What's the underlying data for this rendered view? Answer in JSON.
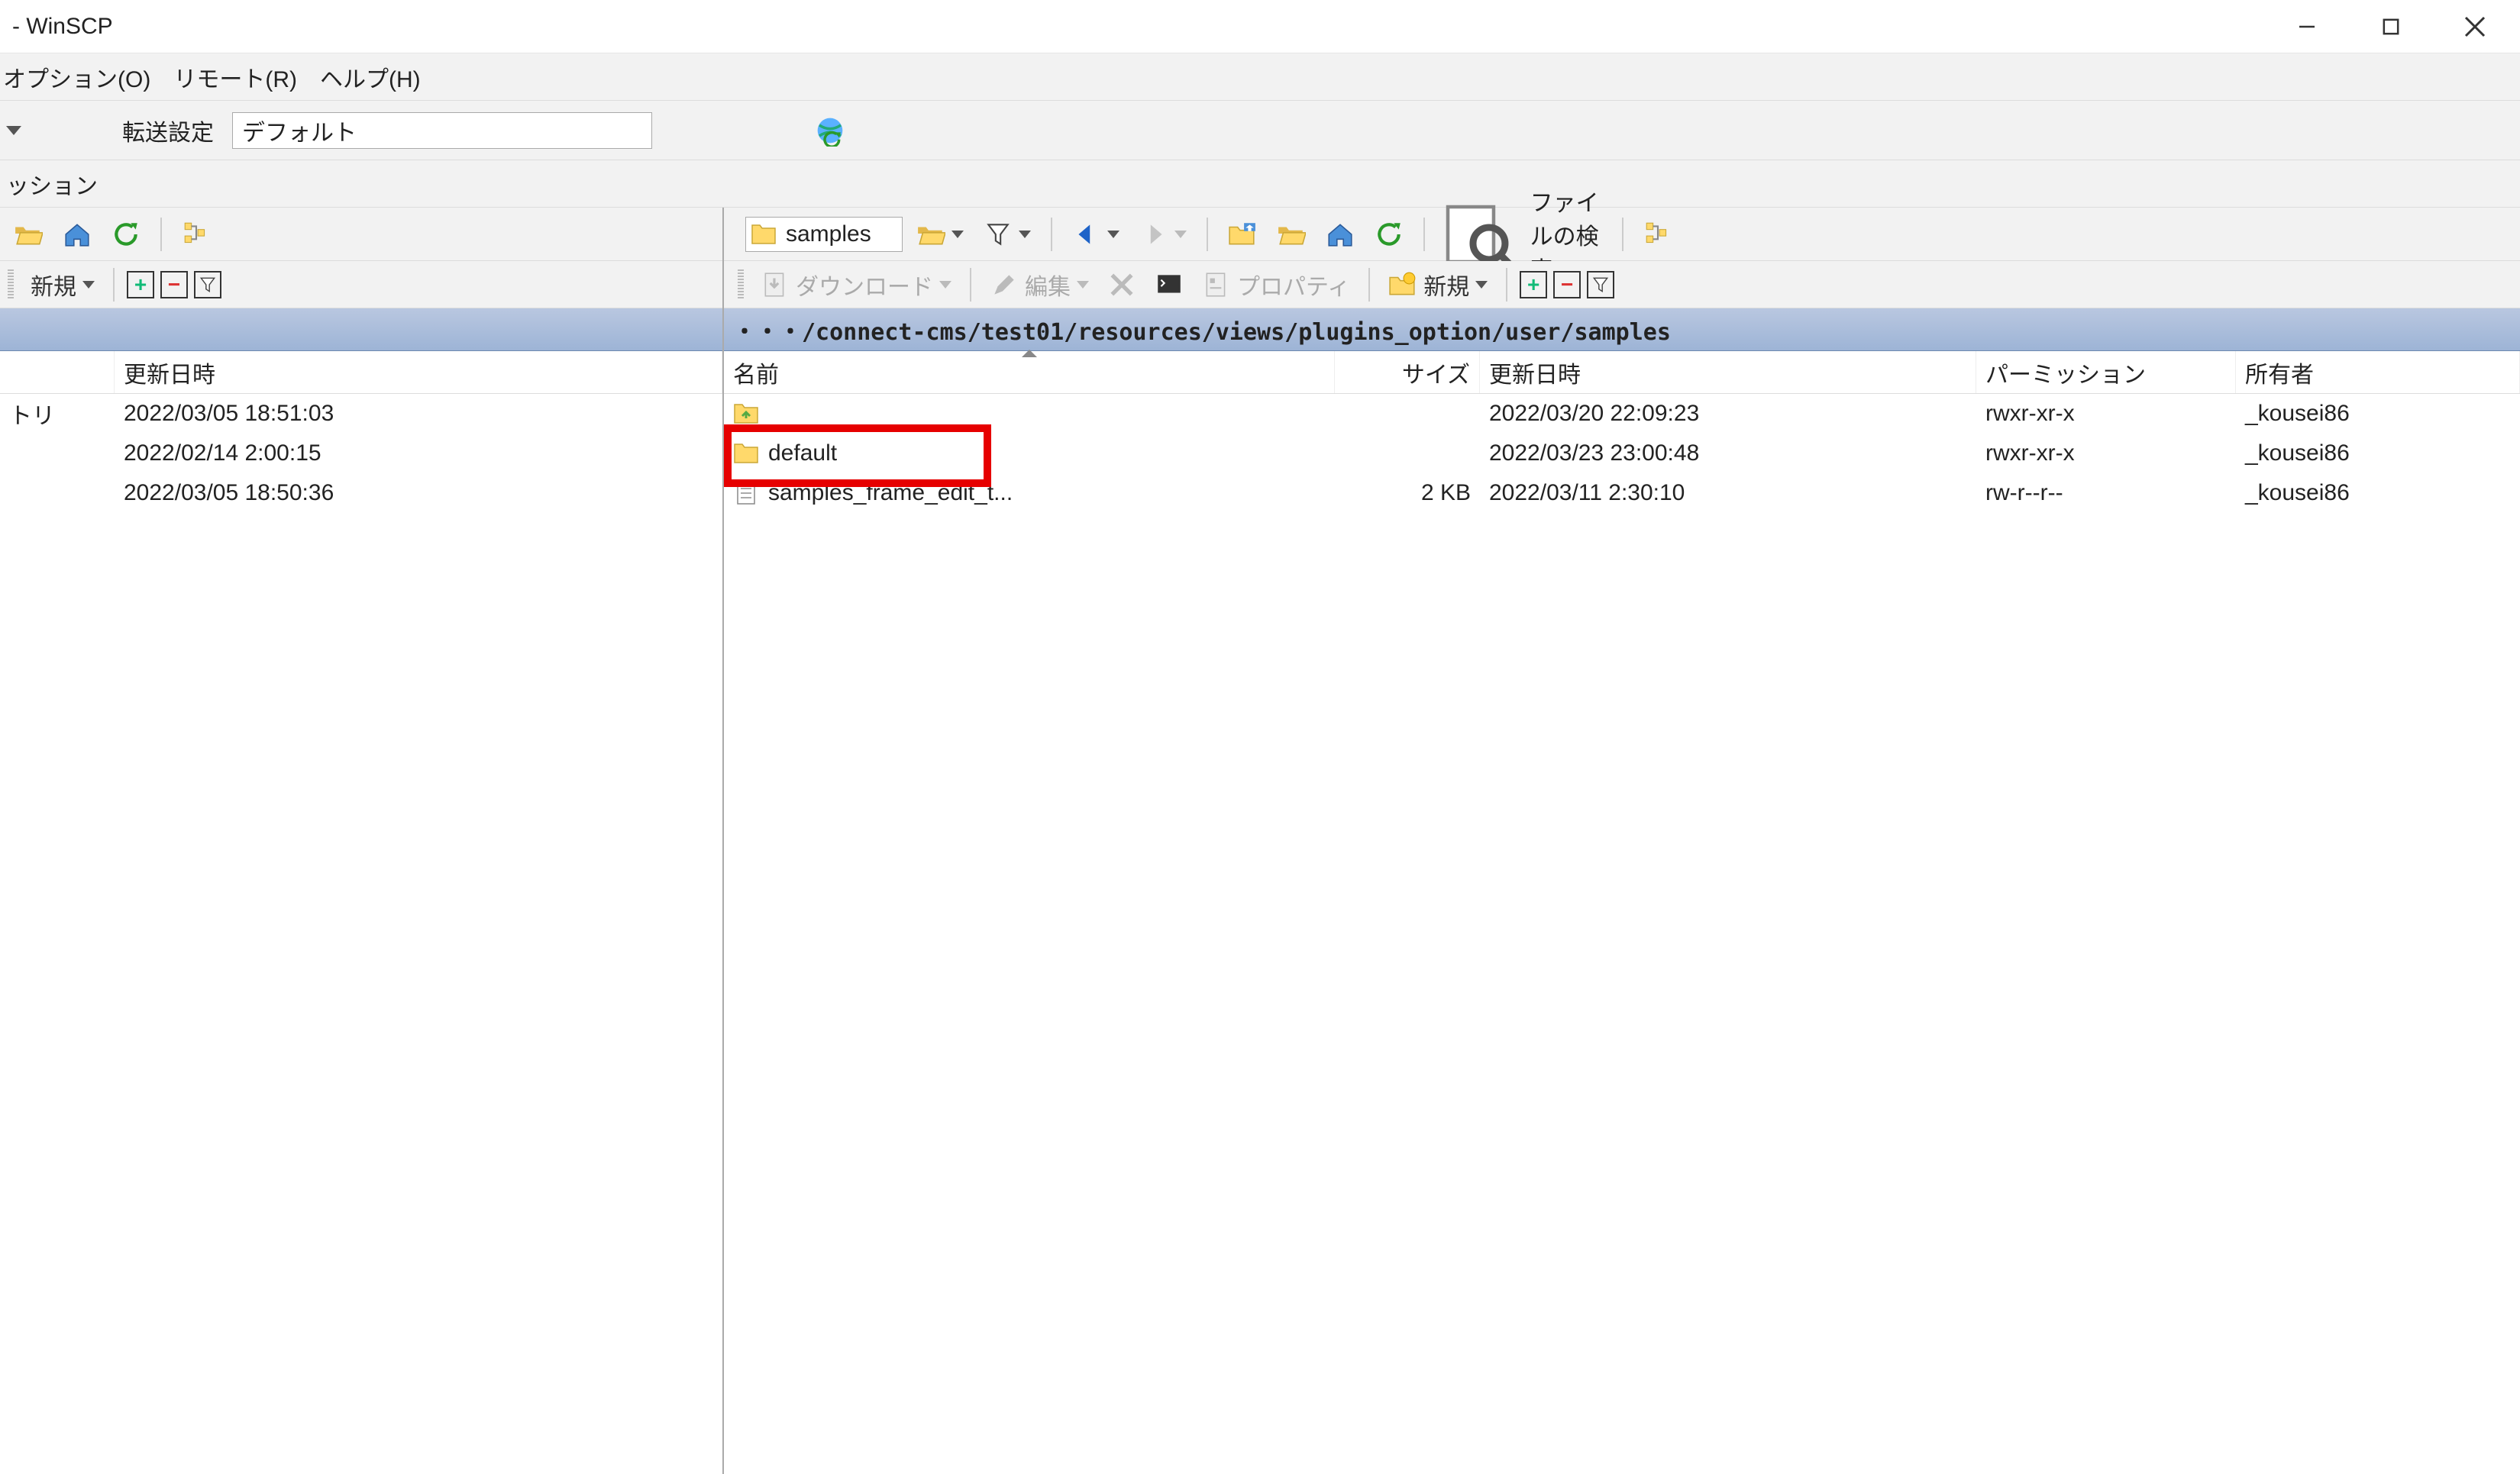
{
  "window": {
    "title": " - WinSCP"
  },
  "menu": {
    "options": "オプション(O)",
    "remote": "リモート(R)",
    "help": "ヘルプ(H)"
  },
  "transfer": {
    "label": "転送設定",
    "value": "デフォルト"
  },
  "session_tab_partial": "ッション",
  "left": {
    "act": {
      "new": "新規"
    },
    "headers": {
      "col1": "",
      "col2": "更新日時"
    },
    "rows": [
      {
        "a": "トリ",
        "b": "2022/03/05  18:51:03"
      },
      {
        "a": "",
        "b": "2022/02/14  2:00:15"
      },
      {
        "a": "",
        "b": "2022/03/05  18:50:36"
      }
    ]
  },
  "right": {
    "dir": "samples",
    "search_label": "ファイルの検索",
    "act": {
      "download": "ダウンロード",
      "edit": "編集",
      "properties": "プロパティ",
      "new": "新規"
    },
    "path": "・・・/connect-cms/test01/resources/views/plugins_option/user/samples",
    "headers": {
      "name": "名前",
      "size": "サイズ",
      "date": "更新日時",
      "perm": "パーミッション",
      "owner": "所有者"
    },
    "rows": [
      {
        "icon": "up",
        "name": "",
        "size": "",
        "date": "2022/03/20 22:09:23",
        "perm": "rwxr-xr-x",
        "owner": "_kousei86"
      },
      {
        "icon": "folder",
        "name": "default",
        "size": "",
        "date": "2022/03/23 23:00:48",
        "perm": "rwxr-xr-x",
        "owner": "_kousei86"
      },
      {
        "icon": "file",
        "name": "samples_frame_edit_t...",
        "size": "2 KB",
        "date": "2022/03/11 2:30:10",
        "perm": "rw-r--r--",
        "owner": "_kousei86"
      }
    ]
  }
}
